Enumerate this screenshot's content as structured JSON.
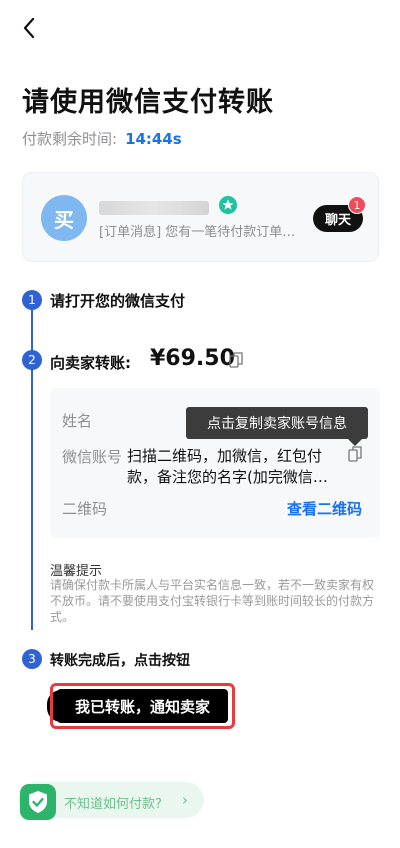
{
  "header": {
    "title": "请使用微信支付转账",
    "timer_label": "付款剩余时间:",
    "timer_value": "14:44s"
  },
  "seller": {
    "avatar_text": "买",
    "message": "[订单消息] 您有一笔待付款订单…",
    "chat_label": "聊天",
    "chat_badge": "1"
  },
  "steps": [
    {
      "number": "1",
      "label": "请打开您的微信支付"
    },
    {
      "number": "2",
      "label": "向卖家转账:",
      "amount": "¥69.50"
    },
    {
      "number": "3",
      "label": "转账完成后，点击按钮"
    }
  ],
  "payment": {
    "name_label": "姓名",
    "account_label": "微信账号",
    "account_value": "扫描二维码，加微信，红包付款，备注您的名字(加完微信…",
    "qr_label": "二维码",
    "qr_link": "查看二维码",
    "tooltip": "点击复制卖家账号信息"
  },
  "tips": {
    "title": "温馨提示",
    "body": "请确保付款卡所属人与平台实名信息一致，若不一致卖家有权不放币。请不要使用支付宝转银行卡等到账时间较长的付款方式。"
  },
  "confirm_button": "我已转账，通知卖家",
  "help": {
    "text": "不知道如何付款?",
    "chevron": "›"
  },
  "colors": {
    "accent_blue": "#1a73e8",
    "step_blue": "#2f63d4",
    "highlight_red": "#e53d3d",
    "help_green": "#6dbf8a",
    "badge_red": "#f24a5b"
  }
}
